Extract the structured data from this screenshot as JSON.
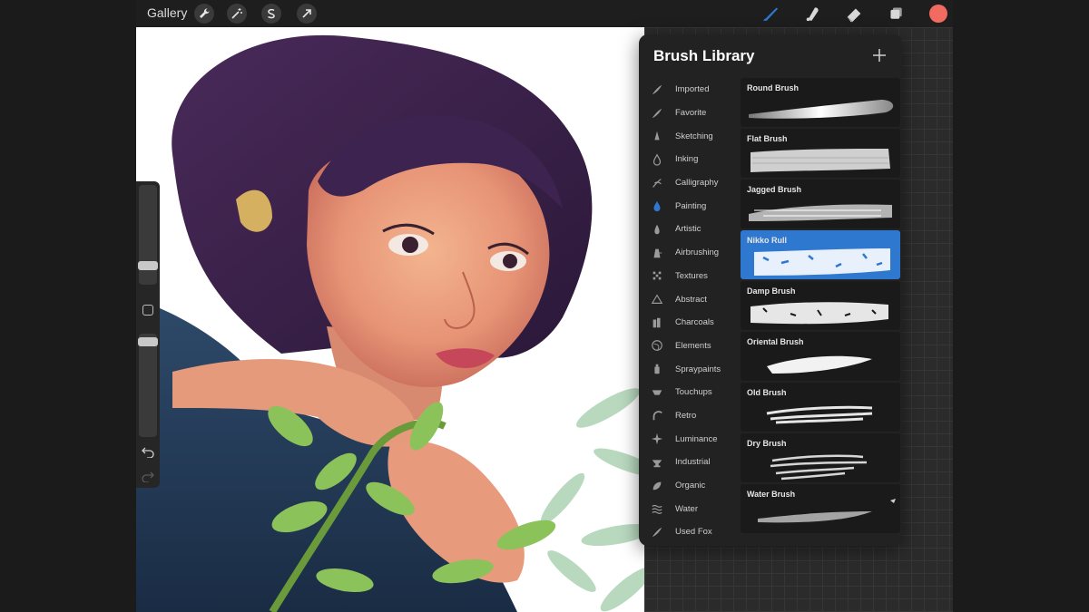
{
  "toolbar": {
    "gallery_label": "Gallery",
    "active_color": "#f26b60",
    "accent_color": "#2f78d0"
  },
  "brush_library": {
    "title": "Brush Library",
    "categories": [
      {
        "label": "Imported",
        "icon": "feather-icon"
      },
      {
        "label": "Favorite",
        "icon": "feather-icon"
      },
      {
        "label": "Sketching",
        "icon": "pencil-tip-icon"
      },
      {
        "label": "Inking",
        "icon": "ink-drop-icon"
      },
      {
        "label": "Calligraphy",
        "icon": "calligraphy-icon"
      },
      {
        "label": "Painting",
        "icon": "paint-drop-icon"
      },
      {
        "label": "Artistic",
        "icon": "brush-tip-icon"
      },
      {
        "label": "Airbrushing",
        "icon": "airbrush-icon"
      },
      {
        "label": "Textures",
        "icon": "texture-icon"
      },
      {
        "label": "Abstract",
        "icon": "triangle-icon"
      },
      {
        "label": "Charcoals",
        "icon": "charcoal-icon"
      },
      {
        "label": "Elements",
        "icon": "globe-icon"
      },
      {
        "label": "Spraypaints",
        "icon": "spraycan-icon"
      },
      {
        "label": "Touchups",
        "icon": "touchup-icon"
      },
      {
        "label": "Retro",
        "icon": "retro-icon"
      },
      {
        "label": "Luminance",
        "icon": "sparkle-icon"
      },
      {
        "label": "Industrial",
        "icon": "anvil-icon"
      },
      {
        "label": "Organic",
        "icon": "leaf-icon"
      },
      {
        "label": "Water",
        "icon": "waves-icon"
      },
      {
        "label": "Used Fox",
        "icon": "feather-icon"
      }
    ],
    "selected_category": "Painting",
    "brushes": [
      {
        "name": "Round Brush"
      },
      {
        "name": "Flat Brush"
      },
      {
        "name": "Jagged Brush"
      },
      {
        "name": "Nikko Rull"
      },
      {
        "name": "Damp Brush"
      },
      {
        "name": "Oriental Brush"
      },
      {
        "name": "Old Brush"
      },
      {
        "name": "Dry Brush"
      },
      {
        "name": "Water Brush"
      }
    ],
    "selected_brush": "Nikko Rull"
  }
}
